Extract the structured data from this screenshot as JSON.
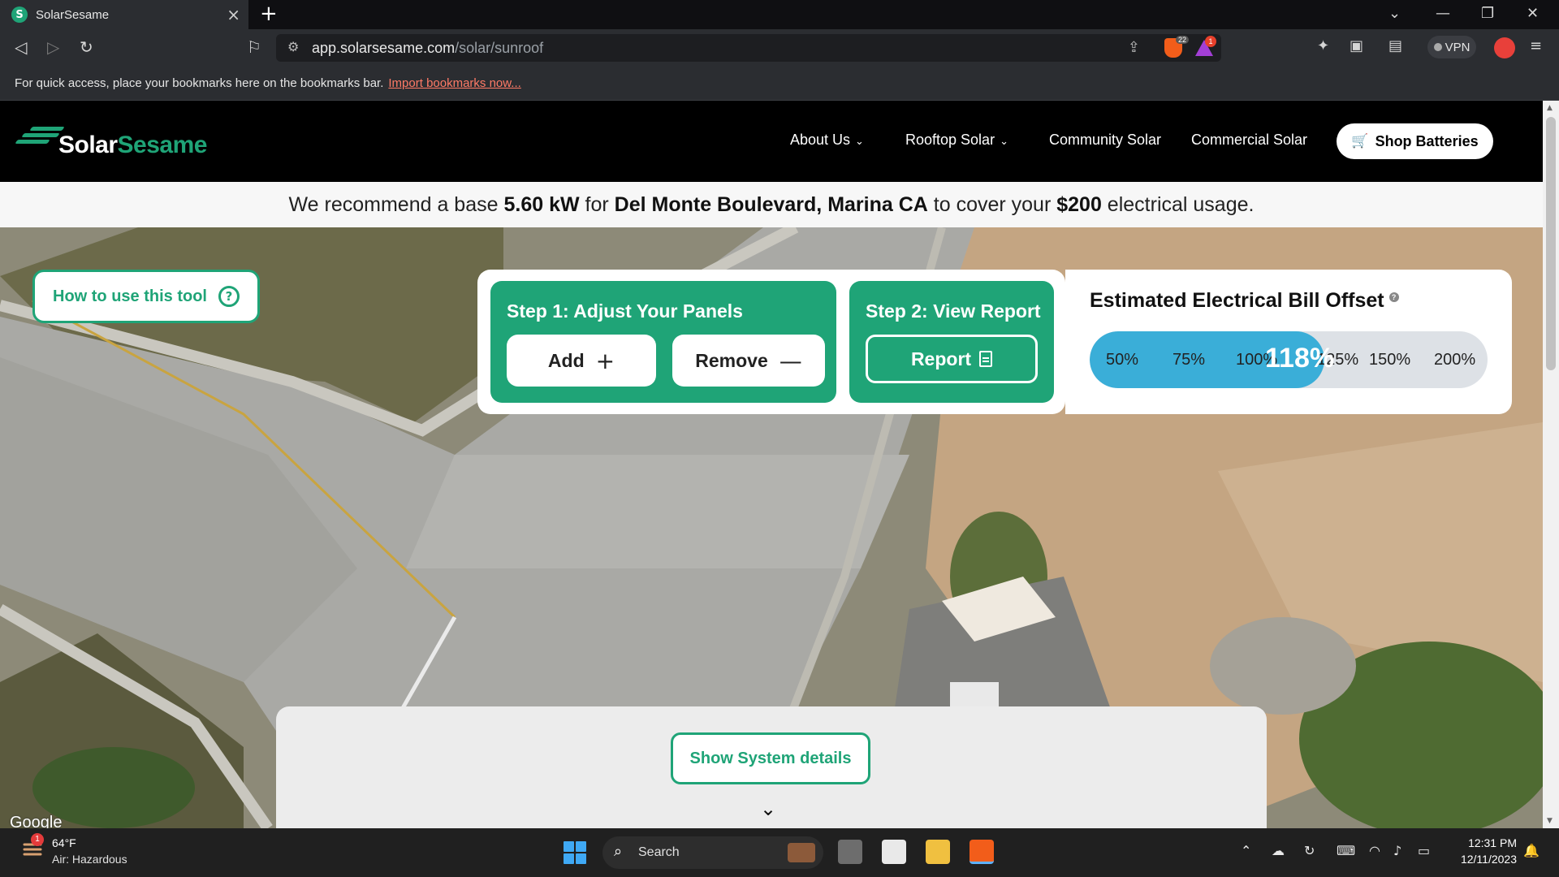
{
  "browser": {
    "tab_title": "SolarSesame",
    "tab_favicon": "S",
    "url_host": "app.solarsesame.com",
    "url_path": "/solar/sunroof",
    "brave_shield_count": "22",
    "rewards_count": "1",
    "vpn_label": "VPN",
    "bookmarks_hint": "For quick access, place your bookmarks here on the bookmarks bar.",
    "bookmarks_link": "Import bookmarks now..."
  },
  "site": {
    "logo_solar": "Solar",
    "logo_sesame": "Sesame",
    "nav": [
      {
        "label": "About Us",
        "dropdown": true
      },
      {
        "label": "Rooftop Solar",
        "dropdown": true
      },
      {
        "label": "Community Solar",
        "dropdown": false
      },
      {
        "label": "Commercial Solar",
        "dropdown": false
      }
    ],
    "shop_label": "Shop Batteries",
    "recommendation": {
      "prefix": "We recommend a base ",
      "size": "5.60 kW",
      "mid1": " for ",
      "address": "Del Monte Boulevard, Marina CA",
      "mid2": " to cover your ",
      "usage": "$200",
      "suffix": " electrical usage."
    },
    "how_to_label": "How to use this tool",
    "step1_title": "Step 1: Adjust Your Panels",
    "add_label": "Add",
    "remove_label": "Remove",
    "step2_title": "Step 2: View Report",
    "report_label": "Report",
    "offset_title": "Estimated Electrical Bill Offset",
    "offset_ticks": [
      "50%",
      "75%",
      "100%",
      "125%",
      "150%",
      "200%"
    ],
    "offset_value": "118%",
    "offset_fraction": 0.59,
    "details_label": "Show System details",
    "map_attribution": "Google"
  },
  "taskbar": {
    "weather_badge": "1",
    "temperature": "64°F",
    "weather_desc": "Air: Hazardous",
    "search_placeholder": "Search",
    "time": "12:31 PM",
    "date": "12/11/2023"
  },
  "colors": {
    "brand_green": "#1fa477",
    "offset_blue": "#3aaed8"
  }
}
